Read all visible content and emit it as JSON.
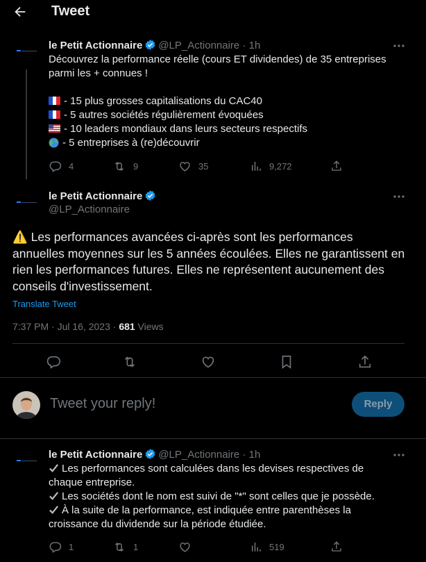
{
  "header": {
    "title": "Tweet"
  },
  "tweet1": {
    "author": "le Petit Actionnaire",
    "handle": "@LP_Actionnaire",
    "time": "· 1h",
    "lines": [
      "Découvrez la performance réelle (cours ET dividendes) de 35 entreprises",
      "parmi les + connues !"
    ],
    "bullets": [
      "- 15 plus grosses capitalisations du CAC40",
      "- 5 autres sociétés régulièrement évoquées",
      "- 10 leaders mondiaux dans leurs secteurs respectifs",
      "- 5 entreprises à (re)découvrir"
    ],
    "stats": {
      "replies": "4",
      "retweets": "9",
      "likes": "35",
      "views": "9,272"
    }
  },
  "main": {
    "author": "le Petit Actionnaire",
    "handle": "@LP_Actionnaire",
    "lines": [
      "⚠️ Les performances avancées ci-après sont les performances",
      "annuelles moyennes sur les 5 années écoulées. Elles ne garantissent en",
      "rien les performances futures. Elles ne représentent aucunement des",
      "conseils d'investissement."
    ],
    "translate": "Translate Tweet",
    "timestamp": "7:37 PM · Jul 16, 2023 · ",
    "views_count": "681",
    "views_label": " Views"
  },
  "reply": {
    "placeholder": "Tweet your reply!",
    "button": "Reply"
  },
  "tweet2": {
    "author": "le Petit Actionnaire",
    "handle": "@LP_Actionnaire",
    "time": "· 1h",
    "lines": [
      "Les performances sont calculées dans les devises respectives de",
      "chaque  entreprise.",
      "Les sociétés dont le nom est suivi de \"*\" sont celles que je possède.",
      "À la suite de la performance, est indiquée entre parenthèses la",
      "croissance du dividende sur la période étudiée."
    ],
    "stats": {
      "replies": "1",
      "retweets": "1",
      "views": "519"
    }
  },
  "colors": {
    "accent": "#1d9bf0",
    "muted": "#71767b",
    "text": "#e7e9ea"
  }
}
